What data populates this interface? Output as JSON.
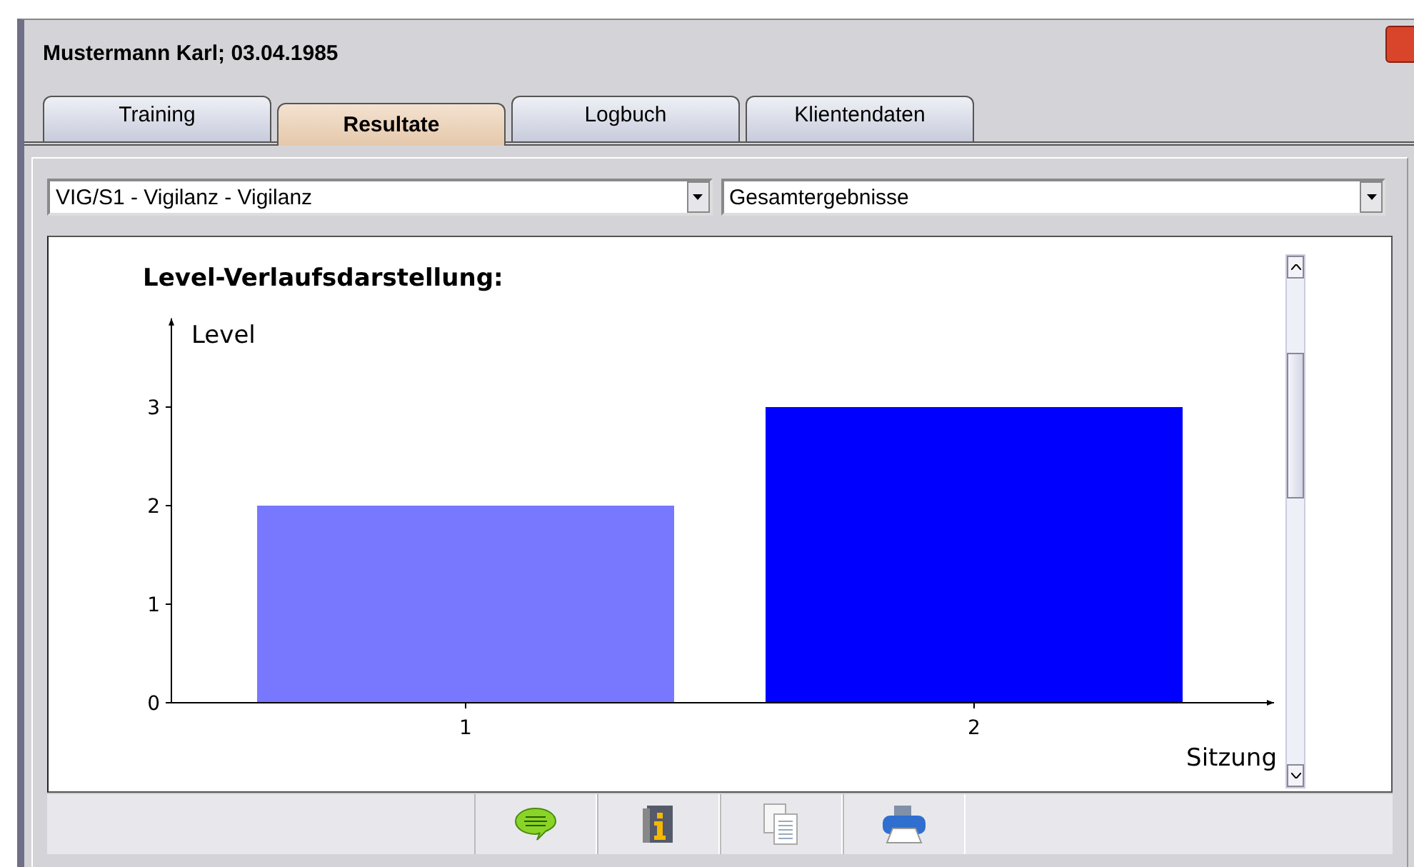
{
  "window": {
    "title": "Mustermann Karl; 03.04.1985"
  },
  "tabs": [
    {
      "label": "Training",
      "selected": false
    },
    {
      "label": "Resultate",
      "selected": true
    },
    {
      "label": "Logbuch",
      "selected": false
    },
    {
      "label": "Klientendaten",
      "selected": false
    }
  ],
  "selectors": [
    {
      "value": "VIG/S1 - Vigilanz - Vigilanz"
    },
    {
      "value": "Gesamtergebnisse"
    }
  ],
  "chart": {
    "chart_data": {
      "type": "bar",
      "title": "Level-Verlaufsdarstellung:",
      "xlabel": "Sitzung",
      "ylabel": "Level",
      "categories": [
        "1",
        "2"
      ],
      "stacked": true,
      "series": [
        {
          "color": "#7878ff",
          "values": [
            2,
            null
          ]
        },
        {
          "color": "#0000ff",
          "values": [
            null,
            3
          ]
        }
      ],
      "ylim": [
        0,
        3.9
      ],
      "yticks": [
        0,
        1,
        2,
        3
      ]
    }
  },
  "toolbar": [
    {
      "kind": "comment"
    },
    {
      "kind": "info"
    },
    {
      "kind": "copy"
    },
    {
      "kind": "print"
    }
  ]
}
